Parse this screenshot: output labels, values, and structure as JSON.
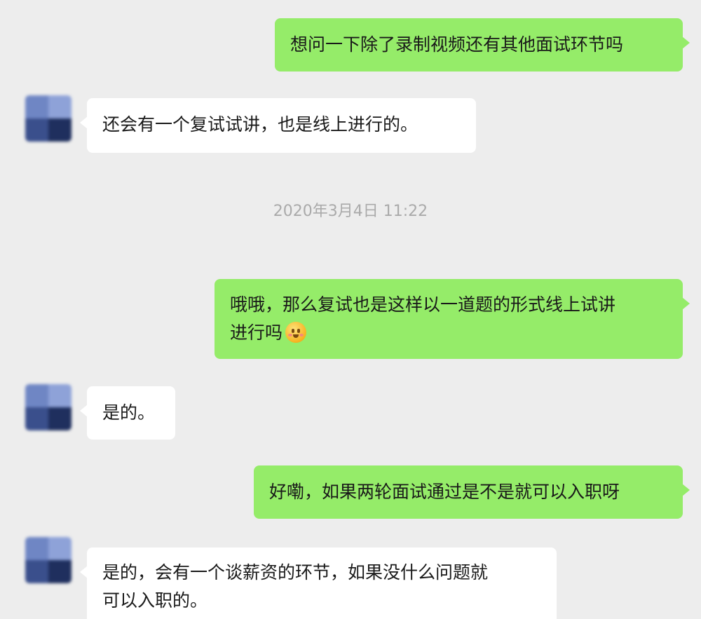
{
  "messages": [
    {
      "side": "out",
      "text": "想问一下除了录制视频还有其他面试环节吗"
    },
    {
      "side": "in",
      "text": "还会有一个复试试讲，也是线上进行的。"
    },
    {
      "side": "out",
      "text_line1": "哦哦，那么复试也是这样以一道题的形式线上试讲",
      "text_line2": "进行吗",
      "emoji": "smiling-face-icon"
    },
    {
      "side": "in",
      "text": "是的。"
    },
    {
      "side": "out",
      "text": "好嘞，如果两轮面试通过是不是就可以入职呀"
    },
    {
      "side": "in",
      "text_line1": "是的，会有一个谈薪资的环节，如果没什么问题就",
      "text_line2": "可以入职的。"
    }
  ],
  "timestamp": "2020年3月4日 11:22",
  "colors": {
    "background": "#ededed",
    "outgoing_bubble": "#95ec69",
    "incoming_bubble": "#ffffff",
    "timestamp_text": "#aaaaaa"
  }
}
